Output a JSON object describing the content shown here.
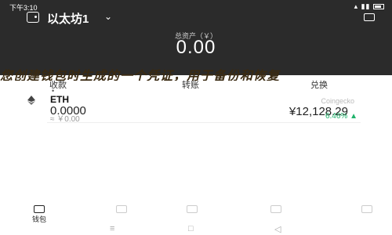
{
  "status_bar": {
    "time": "下午3:10",
    "icons": "▴ ▮▮ "
  },
  "header": {
    "wallet_name": "以太坊1",
    "caret": "⌄",
    "balance_label": "总资产（￥）",
    "balance_value": "0.00"
  },
  "banner": {
    "text": "您创建钱包时生成的一个凭证，用于备份和恢复"
  },
  "actions": {
    "receive": "收款",
    "transfer": "转账",
    "exchange": "兑换"
  },
  "asset": {
    "name": "ETH",
    "source": "Coingecko",
    "amount": "0.0000",
    "amount_fiat": "≈ ￥0.00",
    "price": "¥12,128.29",
    "change": "6.46%",
    "change_arrow": "▲"
  },
  "bottom_nav": {
    "items": [
      {
        "label": "钱包"
      },
      {
        "label": ""
      },
      {
        "label": ""
      },
      {
        "label": ""
      },
      {
        "label": ""
      }
    ]
  },
  "system_nav": {
    "menu": "≡",
    "home": "□",
    "back": "◁"
  },
  "colors": {
    "header_bg": "#2b2b2b",
    "positive": "#1fb36b"
  }
}
